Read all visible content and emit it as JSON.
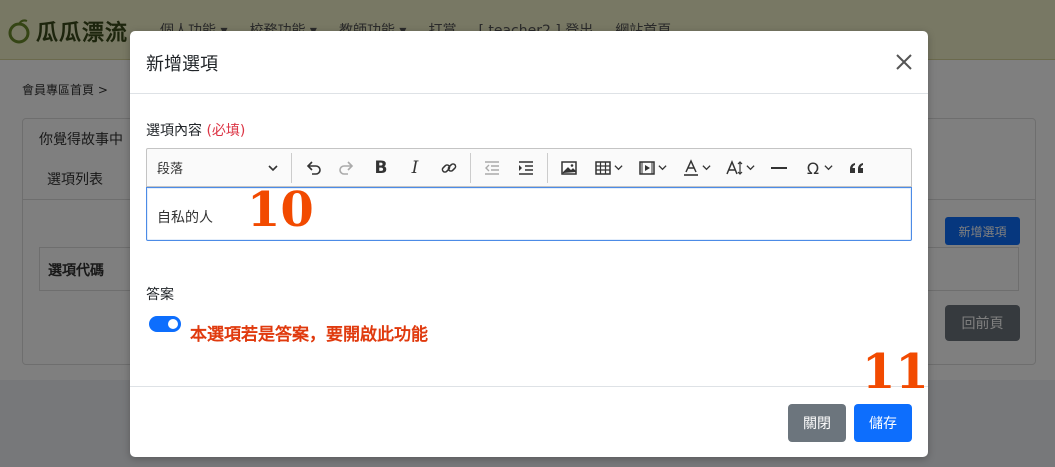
{
  "brand": {
    "name": "瓜瓜漂流"
  },
  "nav": {
    "items": [
      "個人功能 ▾",
      "校務功能 ▾",
      "教師功能 ▾",
      "打賞",
      "[ teacher2 ] 登出",
      "網站首頁"
    ]
  },
  "breadcrumb": {
    "home": "會員專區首頁",
    "separator": ">"
  },
  "card": {
    "title": "你覺得故事中",
    "tab": "選項列表",
    "column_code": "選項代碼"
  },
  "background_buttons": {
    "add": "新增選項",
    "back": "回前頁"
  },
  "modal": {
    "title": "新增選項",
    "field_label": "選項內容",
    "required": "(必填)",
    "editor": {
      "heading": "段落",
      "content": "自私的人",
      "icons": [
        "undo-icon",
        "redo-icon",
        "bold-icon",
        "italic-icon",
        "link-icon",
        "outdent-icon",
        "indent-icon",
        "image-icon",
        "table-icon",
        "media-icon",
        "font-color-icon",
        "text-size-icon",
        "horizontal-line-icon",
        "special-char-icon",
        "blockquote-icon"
      ]
    },
    "answer_label": "答案",
    "answer_toggle_on": true,
    "toggle_hint": "本選項若是答案，要開啟此功能",
    "close_button": "關閉",
    "save_button": "儲存"
  },
  "annotations": {
    "step_10": "10",
    "step_11": "11"
  },
  "colors": {
    "primary": "#0d6efd",
    "secondary": "#6c757d",
    "annotation": "#f24a00",
    "required": "#dc3545",
    "topbar": "#f1f0c9"
  }
}
